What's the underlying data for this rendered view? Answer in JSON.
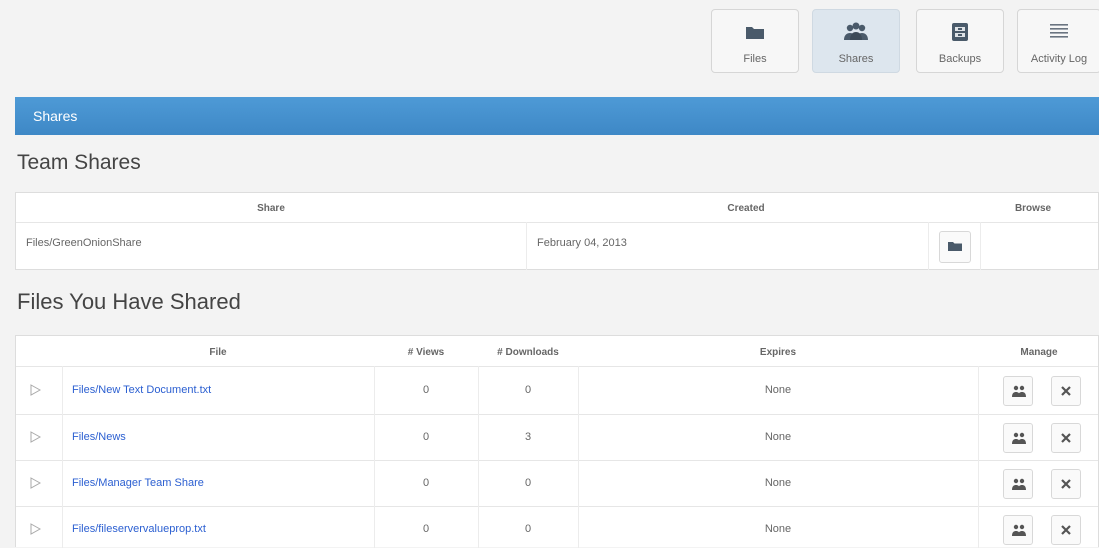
{
  "nav": {
    "items": [
      {
        "label": "Files",
        "icon": "folder-icon",
        "active": false
      },
      {
        "label": "Shares",
        "icon": "users-icon",
        "active": true
      },
      {
        "label": "Backups",
        "icon": "archive-icon",
        "active": false
      },
      {
        "label": "Activity Log",
        "icon": "list-icon",
        "active": false
      }
    ]
  },
  "header": {
    "title": "Shares"
  },
  "team_shares": {
    "title": "Team Shares",
    "columns": [
      "Share",
      "Created",
      "Browse"
    ],
    "rows": [
      {
        "share": "Files/GreenOnionShare",
        "created": "February 04, 2013"
      }
    ]
  },
  "files_shared": {
    "title": "Files You Have Shared",
    "columns": [
      "File",
      "# Views",
      "# Downloads",
      "Expires",
      "Manage"
    ],
    "rows": [
      {
        "file": "Files/New Text Document.txt",
        "views": "0",
        "downloads": "0",
        "expires": "None"
      },
      {
        "file": "Files/News",
        "views": "0",
        "downloads": "3",
        "expires": "None"
      },
      {
        "file": "Files/Manager Team Share",
        "views": "0",
        "downloads": "0",
        "expires": "None"
      },
      {
        "file": "Files/fileservervalueprop.txt",
        "views": "0",
        "downloads": "0",
        "expires": "None"
      }
    ]
  },
  "colors": {
    "accent": "#4590cf",
    "link": "#2b5fd1"
  }
}
